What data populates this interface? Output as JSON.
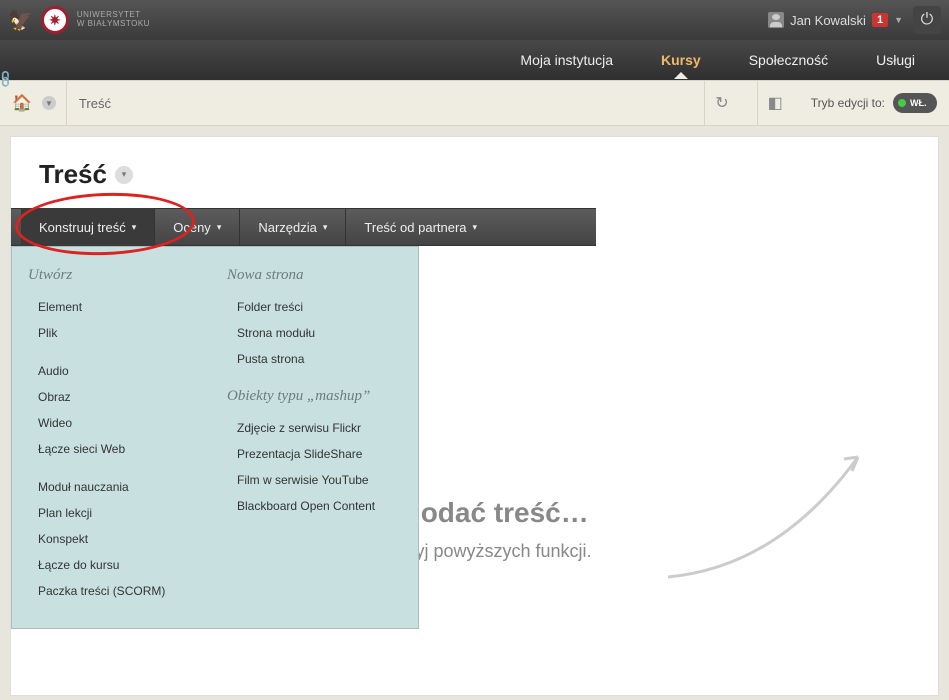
{
  "user": {
    "name": "Jan Kowalski",
    "notifications": "1"
  },
  "university": {
    "line1": "UNIWERSYTET",
    "line2": "W BIAŁYMSTOKU"
  },
  "nav": {
    "institution": "Moja instytucja",
    "courses": "Kursy",
    "community": "Społeczność",
    "services": "Usługi"
  },
  "breadcrumb": {
    "title": "Treść"
  },
  "editmode": {
    "label": "Tryb edycji to:",
    "state": "WŁ."
  },
  "page": {
    "title": "Treść"
  },
  "actionbar": {
    "build": "Konstruuj treść",
    "grades": "Oceny",
    "tools": "Narzędzia",
    "partner": "Treść od partnera"
  },
  "dropdown": {
    "create": {
      "heading": "Utwórz",
      "items_a": [
        "Element",
        "Plik"
      ],
      "items_b": [
        "Audio",
        "Obraz",
        "Wideo",
        "Łącze sieci Web"
      ],
      "items_c": [
        "Moduł nauczania",
        "Plan lekcji",
        "Konspekt",
        "Łącze do kursu",
        "Paczka treści (SCORM)"
      ]
    },
    "newpage": {
      "heading": "Nowa strona",
      "items": [
        "Folder treści",
        "Strona modułu",
        "Pusta strona"
      ]
    },
    "mashup": {
      "heading": "Obiekty typu „mashup”",
      "items": [
        "Zdjęcie z serwisu Flickr",
        "Prezentacja SlideShare",
        "Film w serwisie YouTube",
        "Blackboard Open Content"
      ]
    }
  },
  "placeholder": {
    "title_suffix": "s dodać treść…",
    "subtitle_suffix": "ć, użyj powyższych funkcji."
  }
}
